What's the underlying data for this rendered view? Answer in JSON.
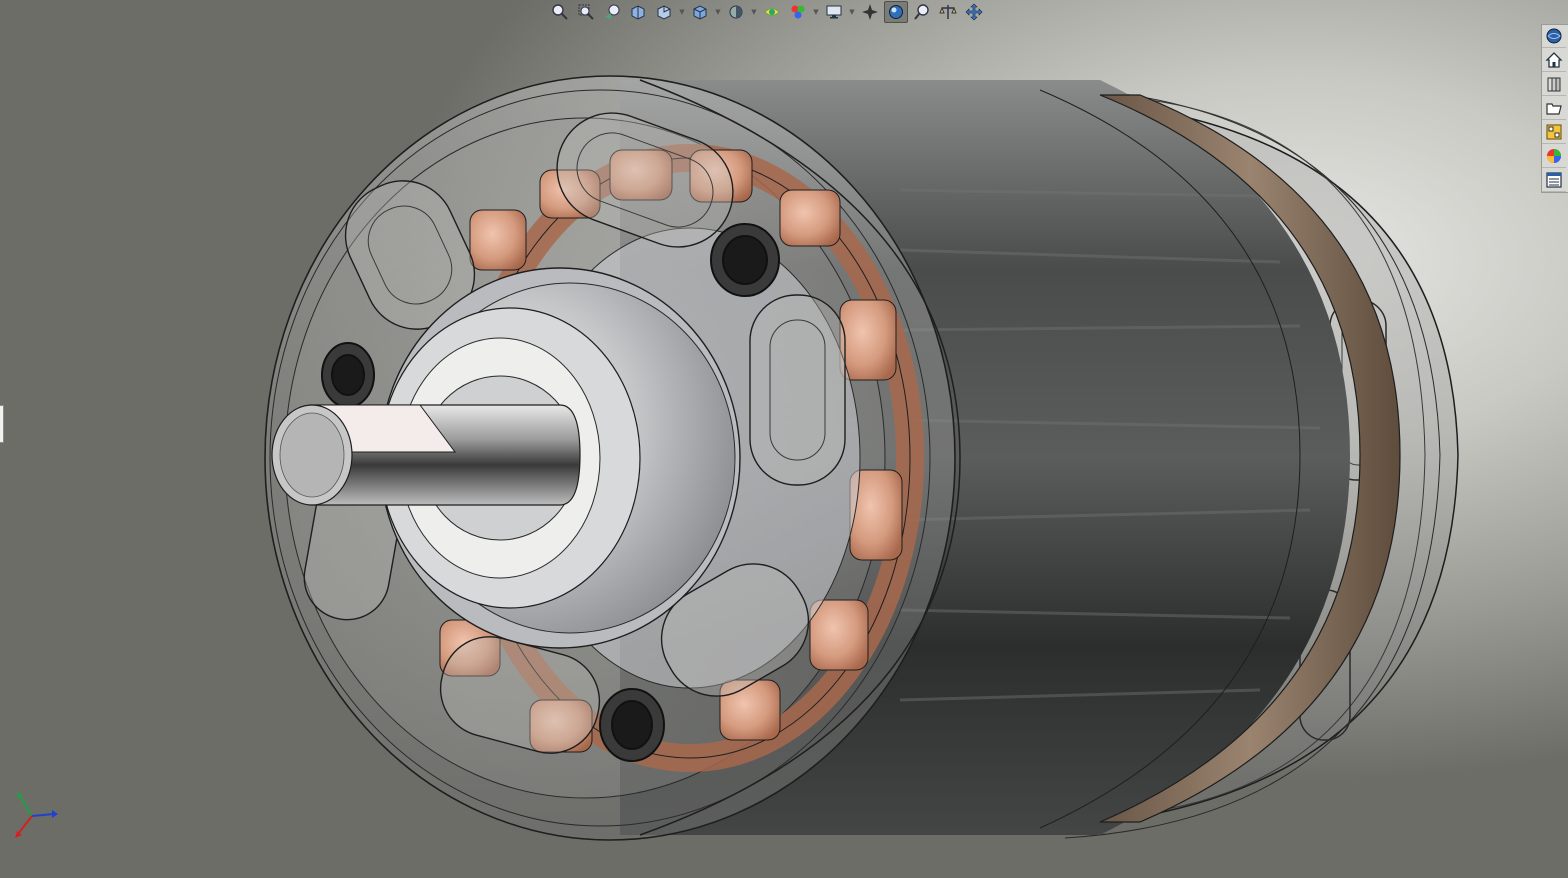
{
  "viewport": {
    "background": "#c9c9c4",
    "model_colors": {
      "housing": "#3c3e3e",
      "housing_highlight": "#8a8c8c",
      "copper": "#d49a7e",
      "steel": "#cfd2d6",
      "gasket": "#8a7460",
      "edges": "#1e1e1e"
    }
  },
  "hud_toolbar": {
    "buttons": [
      {
        "icon": "zoom-to-fit-icon"
      },
      {
        "icon": "zoom-to-area-icon"
      },
      {
        "icon": "previous-view-icon"
      },
      {
        "icon": "section-view-icon"
      },
      {
        "icon": "dynamic-annotation-views-icon"
      },
      {
        "icon": "view-orientation-icon"
      },
      {
        "icon": "display-style-icon"
      },
      {
        "icon": "hide-show-items-icon"
      },
      {
        "icon": "edit-appearance-icon"
      },
      {
        "icon": "apply-scene-icon"
      },
      {
        "icon": "view-settings-icon"
      },
      {
        "icon": "rotate-view-icon"
      },
      {
        "icon": "realview-graphics-icon",
        "active": true
      },
      {
        "icon": "zoom-in-out-icon"
      },
      {
        "icon": "balance-icon"
      },
      {
        "icon": "pan-icon"
      }
    ]
  },
  "task_pane": {
    "tabs": [
      {
        "icon": "solidworks-resources-icon"
      },
      {
        "icon": "home-icon"
      },
      {
        "icon": "design-library-icon"
      },
      {
        "icon": "file-explorer-icon"
      },
      {
        "icon": "view-palette-icon"
      },
      {
        "icon": "appearances-scenes-icon"
      },
      {
        "icon": "custom-properties-icon"
      }
    ]
  },
  "triad": {
    "x_color": "#d42020",
    "y_color": "#20a040",
    "z_color": "#2040d0"
  }
}
